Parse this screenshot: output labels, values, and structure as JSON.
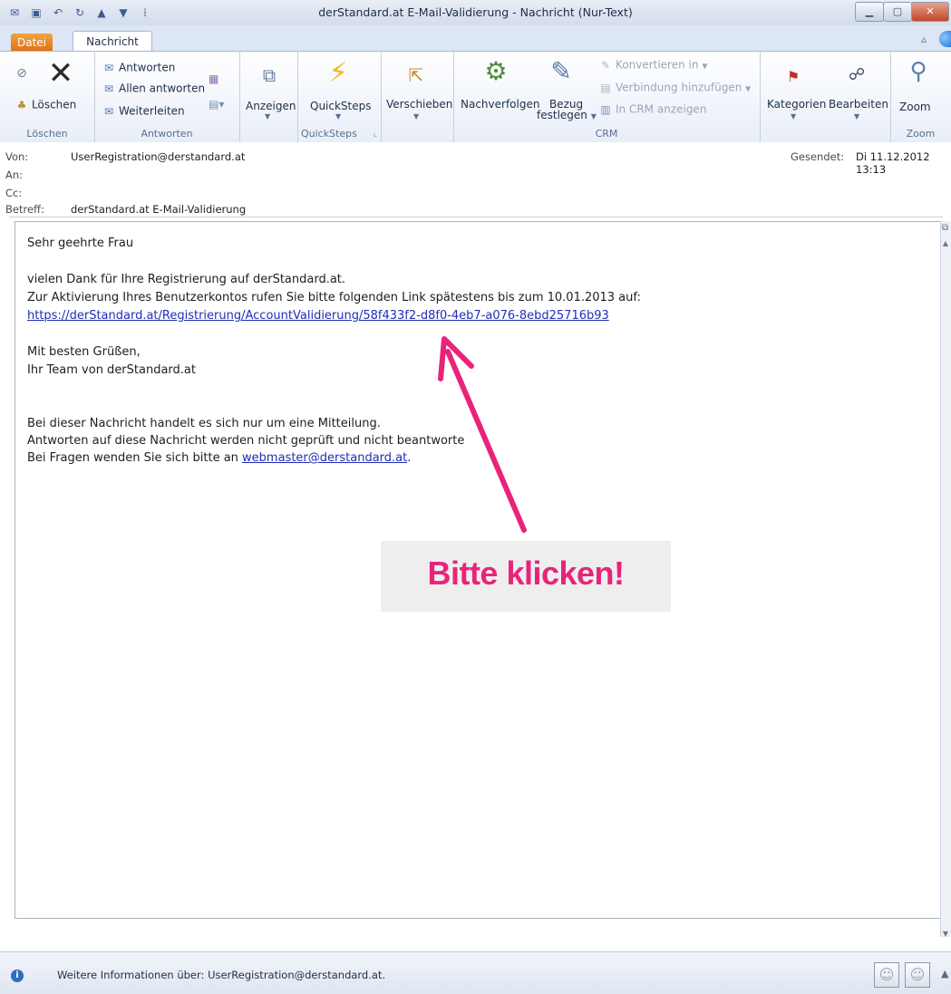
{
  "window": {
    "title": "derStandard.at E-Mail-Validierung  -  Nachricht (Nur-Text)"
  },
  "tabs": {
    "file": "Datei",
    "message": "Nachricht"
  },
  "ribbon": {
    "loeschen": {
      "label": "Löschen",
      "delete": "Löschen"
    },
    "antworten": {
      "label": "Antworten",
      "reply": "Antworten",
      "reply_all": "Allen antworten",
      "forward": "Weiterleiten"
    },
    "anzeigen": "Anzeigen",
    "quicksteps": {
      "label": "QuickSteps",
      "button": "QuickSteps"
    },
    "verschieben": "Verschieben",
    "crm": {
      "label": "CRM",
      "nachverfolgen": "Nachverfolgen",
      "bezug": "Bezug",
      "festlegen": "festlegen",
      "konvertieren": "Konvertieren in",
      "verbindung": "Verbindung hinzufügen",
      "in_crm": "In CRM anzeigen"
    },
    "kategorien": "Kategorien",
    "bearbeiten": "Bearbeiten",
    "zoom": {
      "label": "Zoom",
      "button": "Zoom"
    }
  },
  "header": {
    "von_label": "Von:",
    "von_value": "UserRegistration@derstandard.at",
    "an_label": "An:",
    "cc_label": "Cc:",
    "betreff_label": "Betreff:",
    "betreff_value": "derStandard.at E-Mail-Validierung",
    "gesendet_label": "Gesendet:",
    "gesendet_value": "Di 11.12.2012 13:13"
  },
  "body": {
    "greeting": "Sehr geehrte Frau",
    "line1": "vielen Dank für Ihre Registrierung auf derStandard.at.",
    "line2": "Zur Aktivierung Ihres Benutzerkontos rufen Sie bitte folgenden Link spätestens bis zum 10.01.2013 auf:",
    "link": "https://derStandard.at/Registrierung/AccountValidierung/58f433f2-d8f0-4eb7-a076-8ebd25716b93",
    "regards": "Mit besten Grüßen,",
    "team": "Ihr Team von derStandard.at",
    "note1": "Bei dieser Nachricht handelt es sich nur um eine Mitteilung.",
    "note2": "Antworten auf diese Nachricht werden nicht geprüft und nicht beantworte",
    "note3_prefix": "Bei Fragen wenden Sie sich bitte an ",
    "note3_email": "webmaster@derstandard.at",
    "note3_suffix": "."
  },
  "annotation": {
    "text": "Bitte klicken!",
    "color": "#e8247a"
  },
  "people_pane": {
    "text": "Weitere Informationen über: UserRegistration@derstandard.at."
  }
}
